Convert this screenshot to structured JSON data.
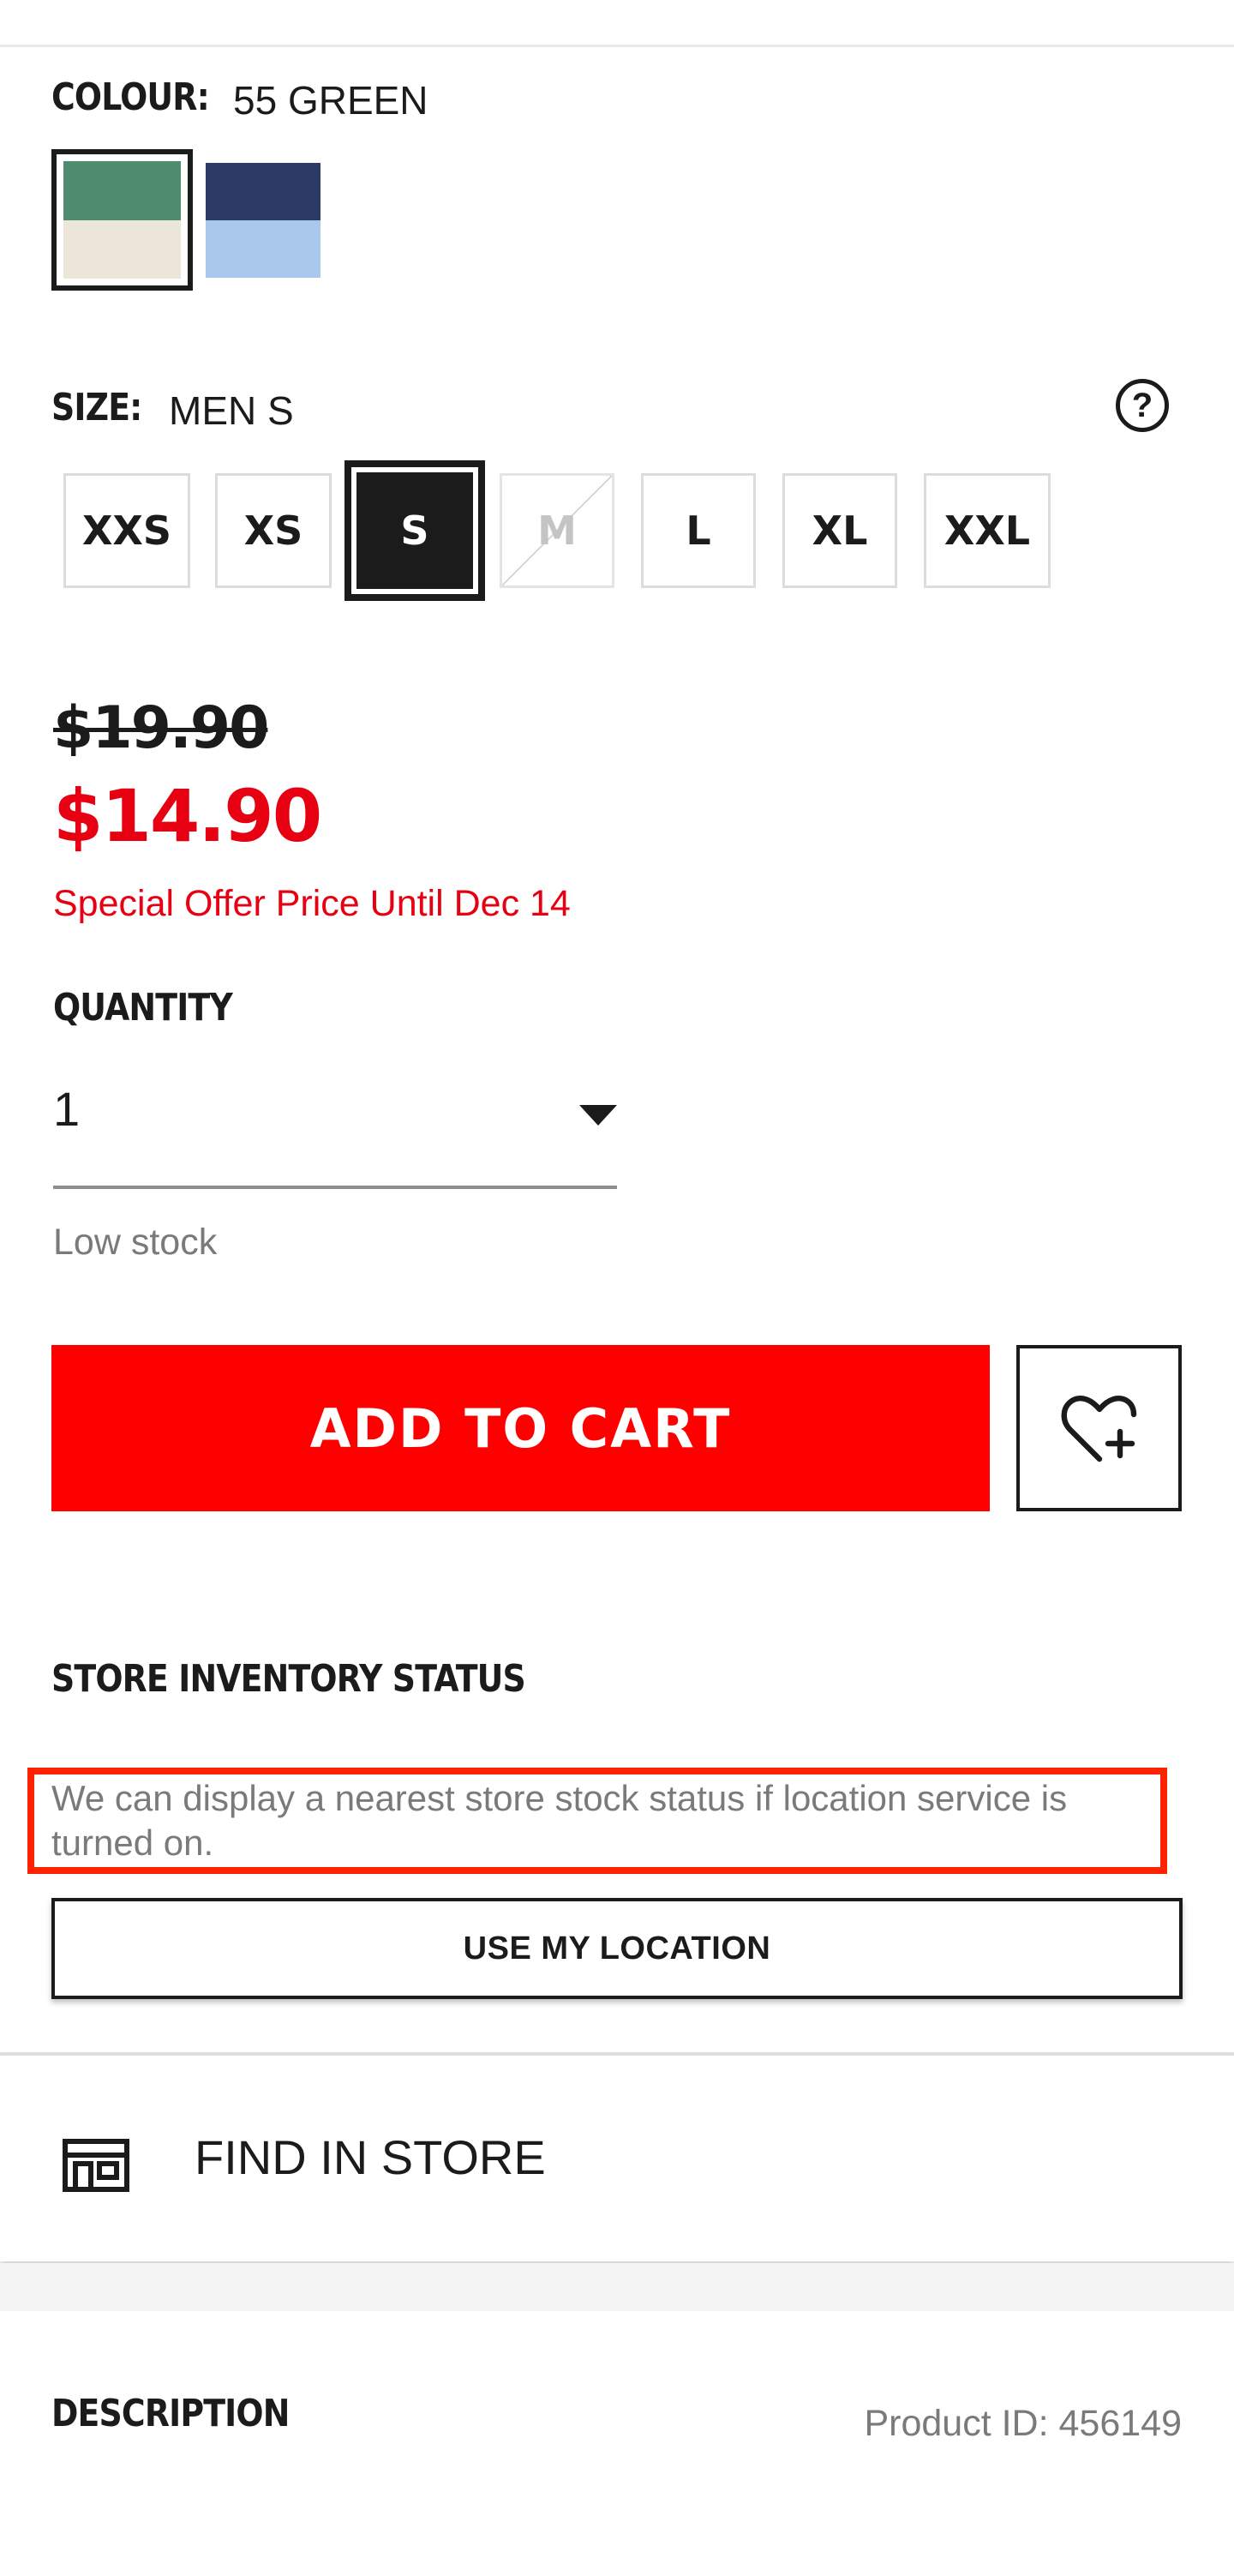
{
  "colour": {
    "label": "COLOUR:",
    "value": "55 GREEN",
    "swatches": [
      {
        "name": "55 GREEN",
        "top_color": "#4f8c6e",
        "bottom_color": "#ece6d8",
        "selected": true
      },
      {
        "name": "NAVY",
        "top_color": "#2c3a66",
        "bottom_color": "#a9c8ec",
        "selected": false
      }
    ]
  },
  "size": {
    "label": "SIZE:",
    "value": "MEN S",
    "help_icon": "question-circle-icon",
    "options": [
      "XXS",
      "XS",
      "S",
      "M",
      "L",
      "XL",
      "XXL"
    ],
    "selected": "S",
    "unavailable": [
      "M"
    ]
  },
  "price": {
    "original": "$19.90",
    "sale": "$14.90",
    "offer_text": "Special Offer Price Until Dec 14",
    "sale_color": "#e60012"
  },
  "quantity": {
    "label": "QUANTITY",
    "value": "1",
    "stock_note": "Low stock"
  },
  "actions": {
    "add_to_cart": "ADD TO CART",
    "add_to_cart_color": "#ff0000",
    "wishlist_icon": "heart-plus-icon"
  },
  "store_inventory": {
    "heading": "STORE INVENTORY STATUS",
    "message": "We can display a nearest store stock status if location service is turned on.",
    "button": "USE MY LOCATION",
    "highlight_color": "#ff2200"
  },
  "find_in_store": {
    "label": "FIND IN STORE",
    "icon": "store-icon"
  },
  "description": {
    "heading": "DESCRIPTION",
    "product_id": "Product ID: 456149"
  }
}
